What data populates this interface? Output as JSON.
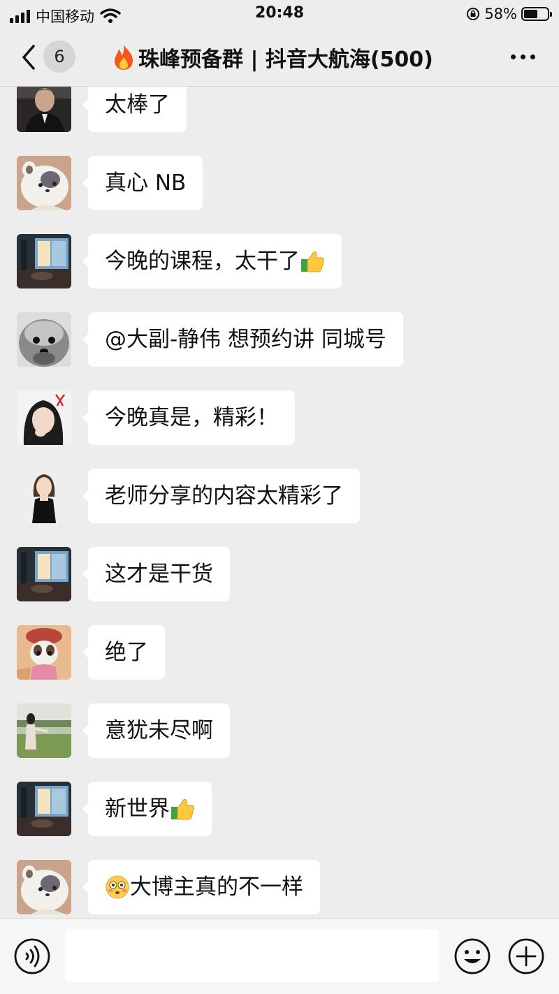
{
  "status_bar": {
    "carrier": "中国移动",
    "time": "20:48",
    "battery_percent": "58%",
    "battery_level": 0.58,
    "icons": [
      "signal-icon",
      "wifi-icon",
      "rotation-lock-icon",
      "battery-icon"
    ]
  },
  "nav": {
    "unread_count": "6",
    "title": "珠峰预备群 | 抖音大航海(500)",
    "icons": [
      "back-chevron-icon",
      "fire-emoji-icon",
      "more-icon"
    ]
  },
  "messages": [
    {
      "avatar": "man-portrait",
      "text": "太棒了"
    },
    {
      "avatar": "cartoon-cat",
      "text": "真心 NB"
    },
    {
      "avatar": "room-window",
      "text": "今晚的课程，太干了",
      "emoji_after": "thumbs-up"
    },
    {
      "avatar": "shaggy-dog",
      "text": "@大副-静伟  想预约讲 同城号"
    },
    {
      "avatar": "woman-bow",
      "text": "今晚真是，精彩！"
    },
    {
      "avatar": "woman-black-dress",
      "text": "老师分享的内容太精彩了"
    },
    {
      "avatar": "room-window",
      "text": "这才是干货"
    },
    {
      "avatar": "kitten-hat",
      "text": "绝了"
    },
    {
      "avatar": "woman-field",
      "text": "意犹未尽啊"
    },
    {
      "avatar": "room-window",
      "text": "新世界",
      "emoji_after": "thumbs-up"
    },
    {
      "avatar": "cartoon-cat",
      "text": "大博主真的不一样",
      "emoji_before": "flushed-face"
    }
  ],
  "input_bar": {
    "text": "",
    "icons": [
      "voice-icon",
      "emoji-icon",
      "plus-icon"
    ]
  }
}
